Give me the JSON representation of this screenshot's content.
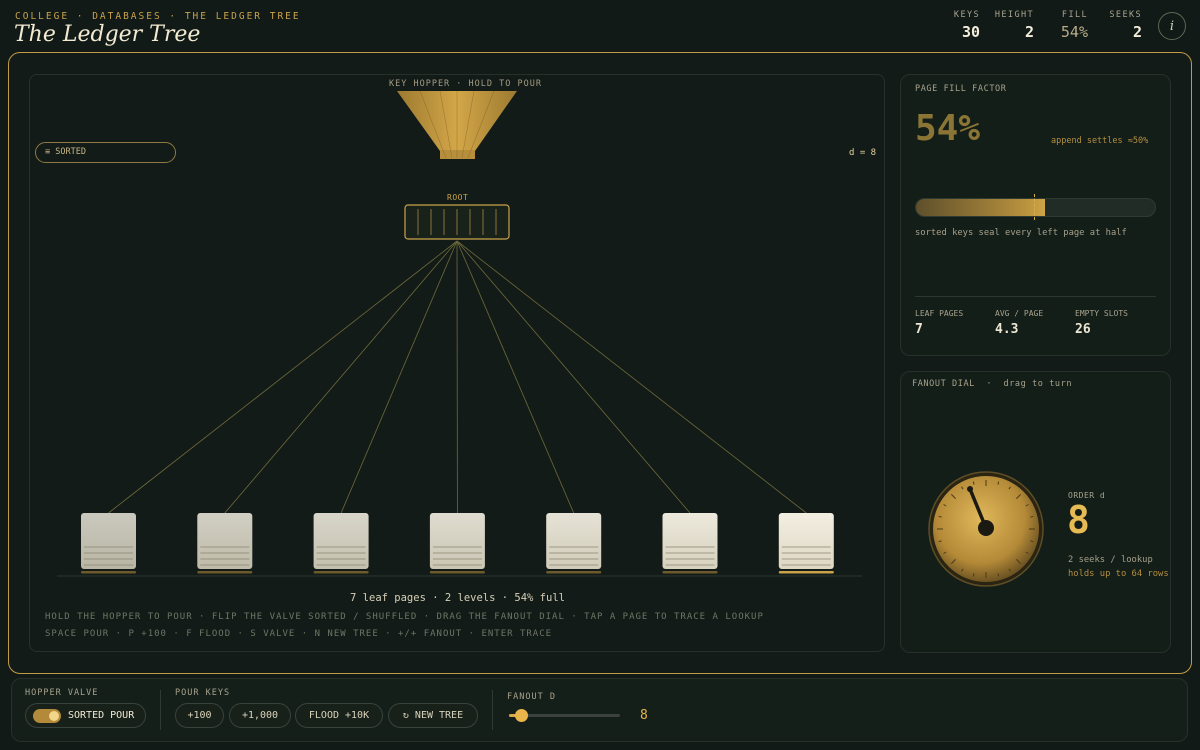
{
  "header": {
    "breadcrumb": "COLLEGE · DATABASES · THE LEDGER TREE",
    "title": "The Ledger Tree",
    "stats": [
      {
        "label": "KEYS",
        "value": "30"
      },
      {
        "label": "HEIGHT",
        "value": "2"
      },
      {
        "label": "FILL",
        "value": "54%"
      },
      {
        "label": "SEEKS",
        "value": "2"
      }
    ],
    "info_glyph": "i"
  },
  "stage": {
    "hopper_label": "KEY HOPPER · HOLD TO POUR",
    "sorted_pill": "≡ SORTED",
    "d_readout": "d = 8",
    "root_label": "ROOT",
    "root_slots": 8,
    "leaf_count": 7,
    "summary": "7 leaf pages · 2 levels · 54% full",
    "help_line_1": "HOLD THE HOPPER TO POUR · FLIP THE VALVE SORTED / SHUFFLED · DRAG THE FANOUT DIAL · TAP A PAGE TO TRACE A LOOKUP",
    "help_line_2": "SPACE POUR · P +100 · F FLOOD · S VALVE · N NEW TREE · +/+ FANOUT · ENTER TRACE"
  },
  "fill_panel": {
    "label": "PAGE FILL FACTOR",
    "percent": "54%",
    "fill_fraction": 0.54,
    "settle_note": "append settles ≈50%",
    "note": "sorted keys seal every left page at half",
    "stats": [
      {
        "label": "LEAF PAGES",
        "value": "7"
      },
      {
        "label": "AVG / PAGE",
        "value": "4.3"
      },
      {
        "label": "EMPTY SLOTS",
        "value": "26"
      }
    ]
  },
  "fanout_panel": {
    "label": "FANOUT DIAL  ·  drag to turn",
    "order_label": "ORDER  d",
    "order_value": "8",
    "seeks_note": "2 seeks / lookup",
    "rows_note": "holds up to 64 rows"
  },
  "controls": {
    "valve_label": "HOPPER VALVE",
    "valve_button": "SORTED POUR",
    "pour_label": "POUR KEYS",
    "pour_buttons": [
      "+100",
      "+1,000",
      "FLOOD +10K",
      "↻ NEW TREE"
    ],
    "fanout_label": "FANOUT  D",
    "fanout_value": "8"
  },
  "colors": {
    "accent": "#c9a24a",
    "background": "#111a16",
    "paper": "#ece7d6"
  }
}
